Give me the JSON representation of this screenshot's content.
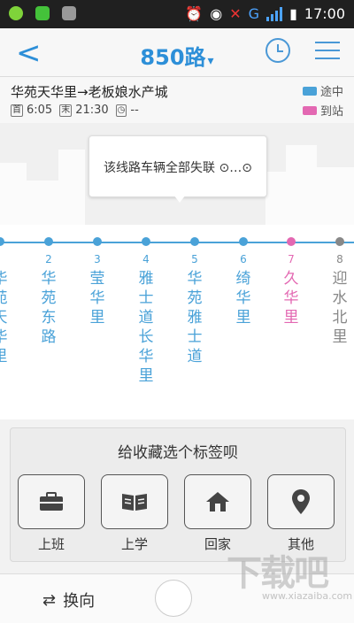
{
  "status_bar": {
    "time": "17:00",
    "network": "G",
    "colors": {
      "bg": "#202020",
      "icon1": "#7fd33a",
      "icon2": "#44c23a"
    }
  },
  "header": {
    "title": "850路",
    "caret": "▾",
    "back_icon": "chevron-left",
    "alarm_icon": "alarm-clock",
    "menu_icon": "hamburger-menu",
    "accent": "#2d8fd8"
  },
  "route": {
    "from_to": "华苑天华里→老板娘水产城",
    "first_tag": "首",
    "first_time": "6:05",
    "last_tag": "末",
    "last_time": "21:30",
    "interval": "--",
    "legend_enroute": "途中",
    "legend_arrived": "到站"
  },
  "tooltip": {
    "text": "该线路车辆全部失联"
  },
  "stops": [
    {
      "num": "",
      "name": "华苑天华里",
      "color": "#4aa2d8"
    },
    {
      "num": "2",
      "name": "华苑东路",
      "color": "#4aa2d8"
    },
    {
      "num": "3",
      "name": "莹华里",
      "color": "#4aa2d8"
    },
    {
      "num": "4",
      "name": "雅士道长华里",
      "color": "#4aa2d8"
    },
    {
      "num": "5",
      "name": "华苑雅士道",
      "color": "#4aa2d8"
    },
    {
      "num": "6",
      "name": "绮华里",
      "color": "#4aa2d8"
    },
    {
      "num": "7",
      "name": "久华里",
      "color": "#e368b2"
    },
    {
      "num": "8",
      "name": "迎水北里",
      "color": "#888888"
    }
  ],
  "sheet": {
    "title": "给收藏选个标签呗",
    "tags": [
      {
        "label": "上班",
        "icon": "briefcase-icon"
      },
      {
        "label": "上学",
        "icon": "book-icon"
      },
      {
        "label": "回家",
        "icon": "home-icon"
      },
      {
        "label": "其他",
        "icon": "map-pin-icon"
      }
    ]
  },
  "bottom": {
    "swap_label": "换向"
  },
  "watermark": {
    "text": "下载吧",
    "sub": "www.xiazaiba.com"
  }
}
